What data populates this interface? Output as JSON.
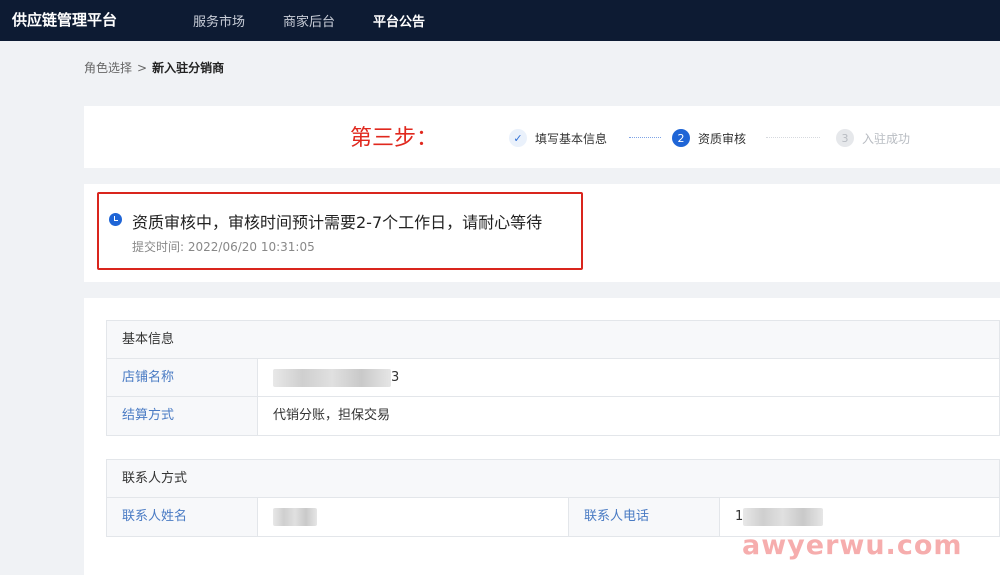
{
  "header": {
    "brand": "供应链管理平台",
    "nav": [
      {
        "label": "服务市场",
        "active": false
      },
      {
        "label": "商家后台",
        "active": false
      },
      {
        "label": "平台公告",
        "active": true
      }
    ]
  },
  "breadcrumb": {
    "parent": "角色选择",
    "separator": ">",
    "current": "新入驻分销商"
  },
  "steps": {
    "annotation": "第三步：",
    "items": [
      {
        "number": "✓",
        "label": "填写基本信息",
        "state": "done"
      },
      {
        "number": "2",
        "label": "资质审核",
        "state": "current"
      },
      {
        "number": "3",
        "label": "入驻成功",
        "state": "pending"
      }
    ]
  },
  "status": {
    "message": "资质审核中，审核时间预计需要2-7个工作日，请耐心等待",
    "submit_label": "提交时间:",
    "submit_time": "2022/06/20 10:31:05",
    "icon": "clock-icon"
  },
  "basic_info": {
    "title": "基本信息",
    "store_name_label": "店铺名称",
    "store_name_tail": "3",
    "settlement_label": "结算方式",
    "settlement_value": "代销分账，担保交易"
  },
  "contact": {
    "title": "联系人方式",
    "name_label": "联系人姓名",
    "phone_label": "联系人电话",
    "phone_head": "1"
  },
  "watermark": "awyerwu.com",
  "colors": {
    "topbar": "#0d1b33",
    "accent": "#1f65d6",
    "highlight_red": "#d9251d",
    "label_blue": "#4a7bc4"
  }
}
